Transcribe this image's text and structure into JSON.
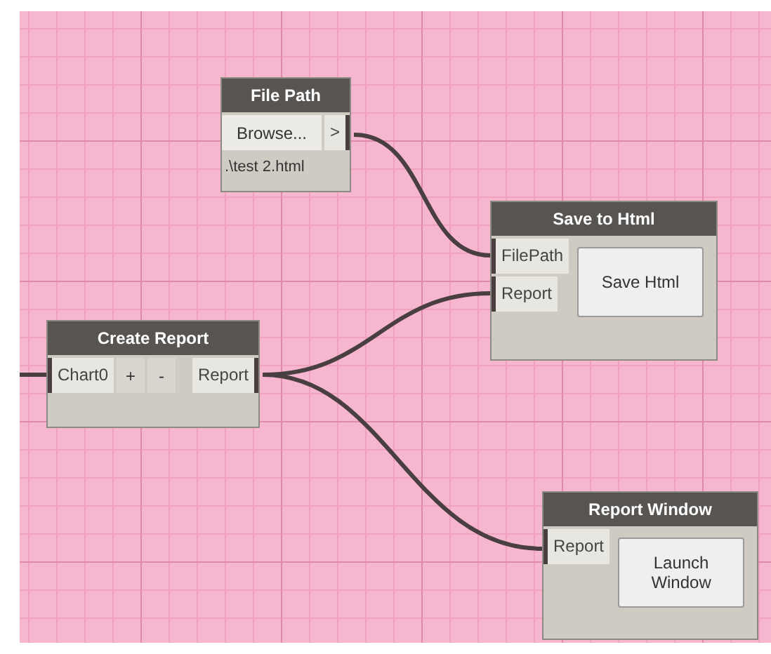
{
  "nodes": [
    {
      "kind": "file-browser",
      "title": "File Path",
      "browse": "Browse...",
      "output": ">",
      "value": ".\\test 2.html"
    },
    {
      "kind": "ui-button",
      "title": "Save to Html",
      "inputs": [
        "FilePath",
        "Report"
      ],
      "button": "Save Html"
    },
    {
      "kind": "variadic",
      "title": "Create Report",
      "inputs": [
        "Chart0"
      ],
      "add": "+",
      "remove": "-",
      "outputs": [
        "Report"
      ]
    },
    {
      "kind": "ui-button",
      "title": "Report Window",
      "inputs": [
        "Report"
      ],
      "button": "Launch Window"
    }
  ]
}
